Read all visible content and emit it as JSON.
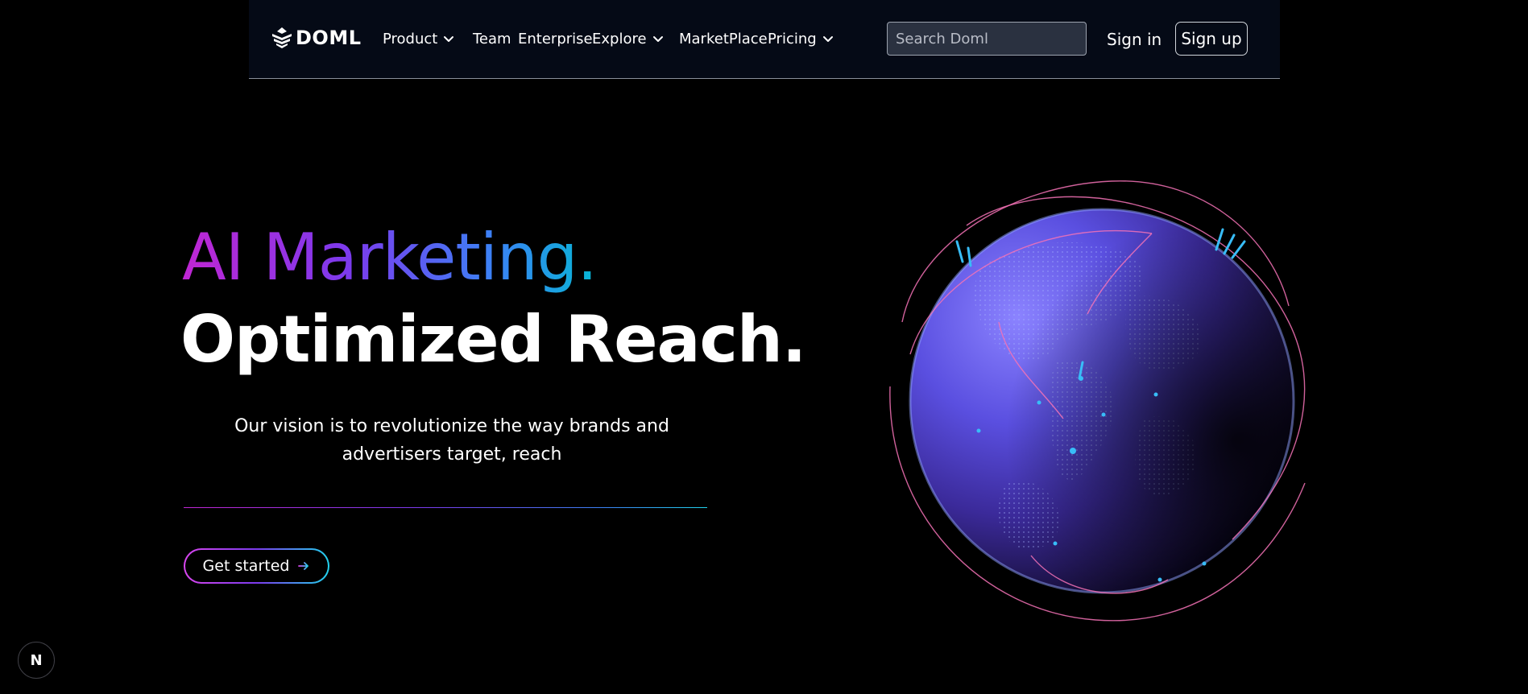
{
  "brand": {
    "logo_text": "DOML",
    "logo_icon": "layered-diamond-logo-icon"
  },
  "nav": {
    "items": [
      {
        "label": "Product",
        "has_dropdown": true
      },
      {
        "label": "Team",
        "has_dropdown": false
      },
      {
        "label": "Enterprise",
        "has_dropdown": false
      },
      {
        "label": "Explore",
        "has_dropdown": true
      },
      {
        "label": "MarketPlace",
        "has_dropdown": false
      },
      {
        "label": "Pricing",
        "has_dropdown": true
      }
    ],
    "search_placeholder": "Search Doml",
    "signin_label": "Sign in",
    "signup_label": "Sign up"
  },
  "hero": {
    "title_line1": "AI Marketing.",
    "title_line2": "Optimized Reach.",
    "subtitle": "Our vision is to revolutionize the way brands and advertisers target, reach",
    "cta_label": "Get started",
    "cta_icon": "arrow-right-icon",
    "visual": "glowing-globe-illustration"
  },
  "badge": {
    "label": "N"
  },
  "colors": {
    "background": "#000000",
    "nav_background": "#050a16",
    "gradient_start": "#c026d3",
    "gradient_mid": "#7c3aed",
    "gradient_end": "#06b6d4",
    "globe_blue": "#4f46e5",
    "arc_pink": "#f472b6"
  }
}
